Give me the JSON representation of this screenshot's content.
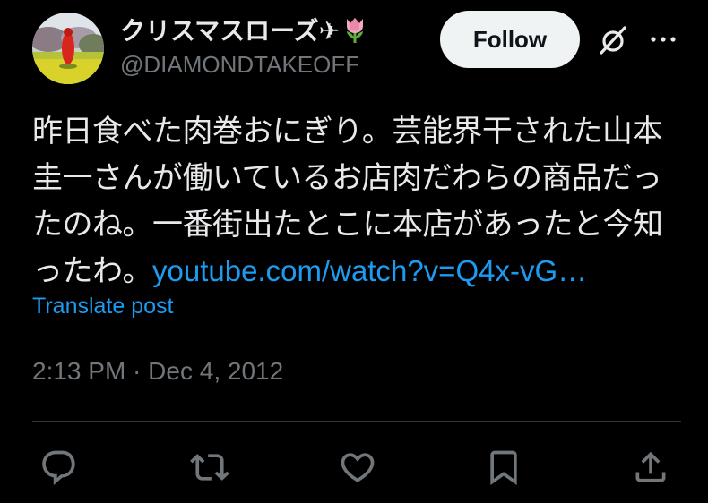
{
  "author": {
    "display_name": "クリスマスローズ✈",
    "display_emoji": "🌷",
    "handle": "@DIAMONDTAKEOFF",
    "avatar": "avatar-photo-red-figure-in-field"
  },
  "follow_button": {
    "label": "Follow"
  },
  "tweet": {
    "text_lines": [
      "昨日食べた肉巻おにぎり。芸能界干された山本",
      "圭一さんが働いているお店肉だわらの商品だっ",
      "たのね。一番街出たとこに本店があったと今知",
      "ったわ。"
    ],
    "link_text": "youtube.com/watch?v=Q4x-vG…",
    "translate_label": "Translate post",
    "time": "2:13 PM",
    "separator": " · ",
    "date": "Dec 4, 2012"
  },
  "actions": [
    "reply-icon",
    "repost-icon",
    "like-icon",
    "bookmark-icon",
    "share-icon"
  ],
  "colors": {
    "background": "#000000",
    "text": "#e7e9ea",
    "secondary": "#71767b",
    "link": "#1d9bf0",
    "follow_bg": "#eff3f4",
    "divider": "#2f3336"
  }
}
